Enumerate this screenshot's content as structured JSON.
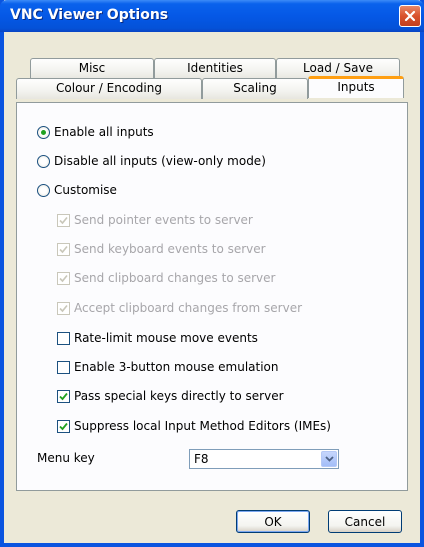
{
  "window": {
    "title": "VNC Viewer Options",
    "accent": "#0a54e0"
  },
  "tabs": {
    "row1": [
      {
        "label": "Misc"
      },
      {
        "label": "Identities"
      },
      {
        "label": "Load / Save"
      }
    ],
    "row2": [
      {
        "label": "Colour / Encoding"
      },
      {
        "label": "Scaling"
      },
      {
        "label": "Inputs",
        "active": true
      }
    ]
  },
  "inputs": {
    "radio_enable_all": {
      "label": "Enable all inputs",
      "selected": true
    },
    "radio_disable_all": {
      "label": "Disable all inputs (view-only mode)",
      "selected": false
    },
    "radio_customise": {
      "label": "Customise",
      "selected": false
    },
    "send_pointer": {
      "label": "Send pointer events to server",
      "checked": true,
      "enabled": false
    },
    "send_keyboard": {
      "label": "Send keyboard events to server",
      "checked": true,
      "enabled": false
    },
    "send_clipboard": {
      "label": "Send clipboard changes to server",
      "checked": true,
      "enabled": false
    },
    "accept_clipboard": {
      "label": "Accept clipboard changes from server",
      "checked": true,
      "enabled": false
    },
    "rate_limit": {
      "label": "Rate-limit mouse move events",
      "checked": false
    },
    "three_button": {
      "label": "Enable 3-button mouse emulation",
      "checked": false
    },
    "pass_special": {
      "label": "Pass special keys directly to server",
      "checked": true
    },
    "suppress_ime": {
      "label": "Suppress local Input Method Editors (IMEs)",
      "checked": true
    },
    "menu_key": {
      "label": "Menu key",
      "value": "F8"
    }
  },
  "buttons": {
    "ok": "OK",
    "cancel": "Cancel"
  }
}
